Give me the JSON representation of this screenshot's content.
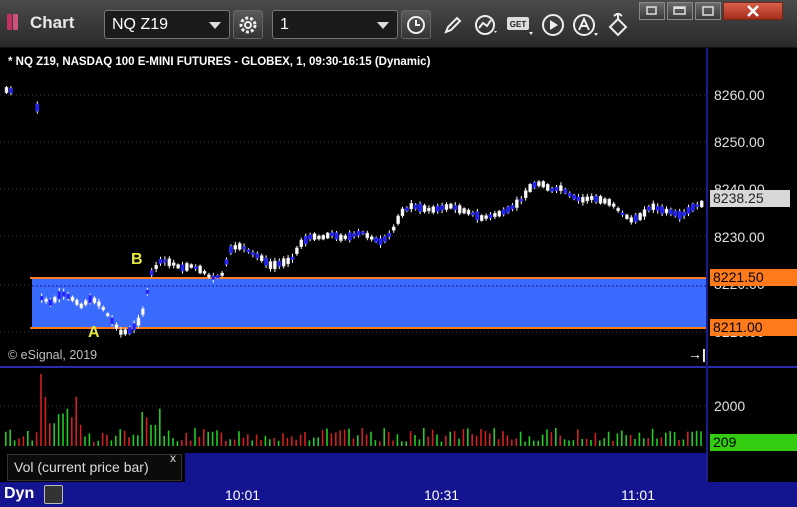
{
  "app": {
    "title": "Chart"
  },
  "toolbar": {
    "symbol": "NQ Z19",
    "interval": "1",
    "get_label": "GET",
    "icons": [
      "settings-gear-icon",
      "clock-icon",
      "pencil-icon",
      "cursor-mode-icon",
      "get-data-icon",
      "play-icon",
      "alerts-icon",
      "link-icon"
    ]
  },
  "window_controls": [
    "restore-icon",
    "maximize-icon",
    "close-icon"
  ],
  "chart": {
    "header": "* NQ Z19, NASDAQ 100 E-MINI FUTURES - GLOBEX, 1, 09:30-16:15 (Dynamic)",
    "copyright": "© eSignal, 2019",
    "marker_a": "A",
    "marker_b": "B",
    "current_price": "8238.25",
    "range_high": "8221.50",
    "range_low": "8211.00",
    "price_ticks": [
      "8260.00",
      "8250.00",
      "8240.00",
      "8230.00",
      "8220.00",
      "8210.00"
    ],
    "volume_tick": "2000",
    "volume_current": "209",
    "volume_study_label": "Vol (current price bar)",
    "volume_close": "x",
    "time_labels": [
      "10:01",
      "10:31",
      "11:01"
    ],
    "dynamic_button": "Dyn",
    "colors": {
      "up_bar": "#ffffff",
      "down_bar": "#1e1eff",
      "range_fill": "#3a6bff",
      "range_line": "#ff7a1a",
      "price_tag_orange": "#ff7a1a",
      "vol_up": "#22cc22",
      "vol_down": "#d02020",
      "vol_tag": "#33cc11",
      "axis_blue": "#141490"
    }
  }
}
